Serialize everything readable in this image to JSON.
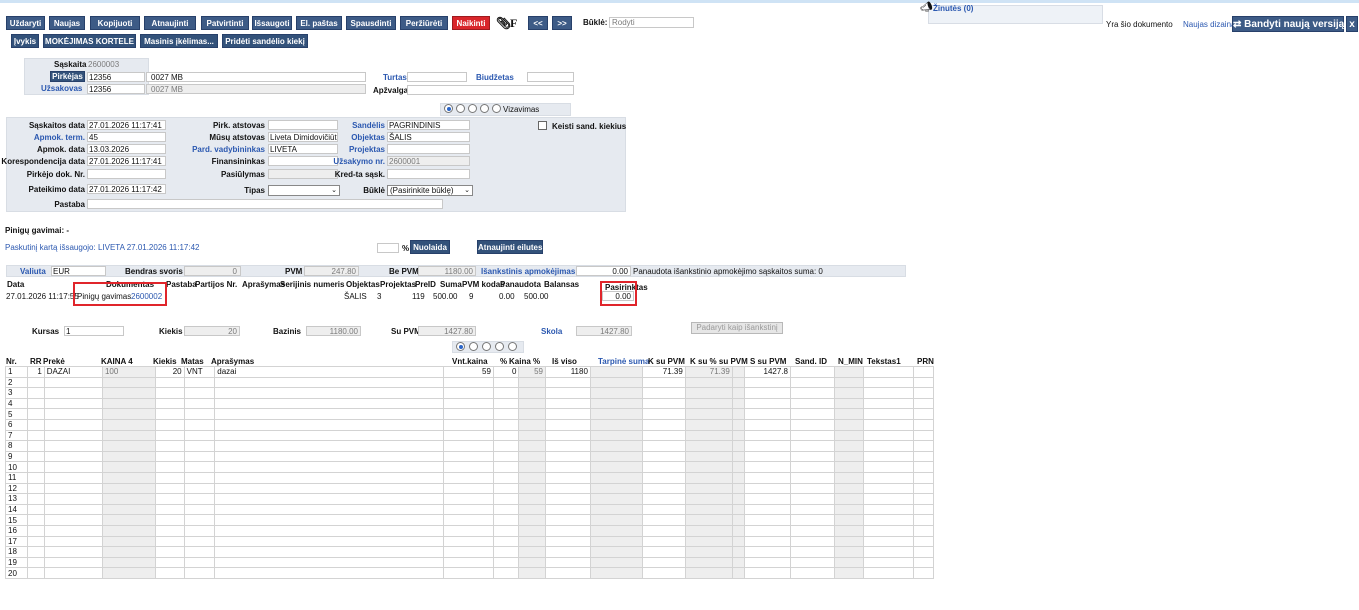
{
  "toolbar": {
    "close": "Uždaryti",
    "new": "Naujas",
    "copy": "Kopijuoti",
    "refresh": "Atnaujinti",
    "confirm": "Patvirtinti",
    "save": "Išsaugoti",
    "email": "El. paštas",
    "print": "Spausdinti",
    "preview": "Peržiūrėti",
    "cancel": "Naikinti",
    "attach_icon": "paperclip-icon",
    "f_label": "F",
    "prev": "<<",
    "next": ">>",
    "status_label": "Būklė:",
    "status_value": "Rodyti",
    "events": "Įvykis",
    "payment_card": "MOKĖJIMAS KORTELE",
    "mass_upload": "Masinis įkėlimas...",
    "add_stock": "Pridėti sandėlio kiekį"
  },
  "news": {
    "label": "Žinutės (0)",
    "icon": "megaphone-icon"
  },
  "design_notice": {
    "prefix": "Yra šio dokumento",
    "link": "Naujas dizainas.",
    "try_button": "Bandyti naują versiją",
    "close": "x"
  },
  "header": {
    "invoice_label": "Sąskaita",
    "invoice_value": "2600003",
    "buyer_label": "Pirkėjas",
    "buyer_code": "12356",
    "buyer_name": "0027 MB",
    "customer_label": "Užsakovas",
    "customer_code": "12356",
    "customer_name": "0027 MB",
    "asset_label": "Turtas",
    "budget_label": "Biudžetas",
    "insurance_label": "Apžvalga",
    "vizavimas": "Vizavimas"
  },
  "details": {
    "inv_date_label": "Sąskaitos data",
    "inv_date": "27.01.2026 11:17:41",
    "pay_term_label": "Apmok. term.",
    "pay_term": "45",
    "pay_date_label": "Apmok. data",
    "pay_date": "13.03.2026",
    "corr_date_label": "Korespondencija data",
    "corr_date": "27.01.2026 11:17:41",
    "buyer_doc_label": "Pirkėjo dok. Nr.",
    "submit_date_label": "Pateikimo data",
    "submit_date": "27.01.2026 11:17:42",
    "note_label": "Pastaba",
    "buyer_rep_label": "Pirk. atstovas",
    "our_rep_label": "Mūsų atstovas",
    "our_rep": "Liveta Dimidovičiūtė",
    "sales_mgr_label": "Pard. vadybininkas",
    "sales_mgr": "LIVETA",
    "financier_label": "Finansininkas",
    "offer_label": "Pasiūlymas",
    "type_label": "Tipas",
    "type_value": "",
    "warehouse_label": "Sandėlis",
    "warehouse": "PAGRINDINIS",
    "object_label": "Objektas",
    "object": "ŠALIS",
    "project_label": "Projektas",
    "order_label": "Užsakymo nr.",
    "order": "2600001",
    "credit_label": "Kred-ta sąsk.",
    "state_label": "Būklė",
    "state_value": "(Pasirinkite būklę)",
    "change_qty_label": "Keisti sand. kiekius"
  },
  "payments": {
    "received_label": "Pinigų gavimai: -",
    "last_saved": "Paskutinį kartą išsaugojo: LIVETA 27.01.2026 11:17:42",
    "percent_sign": "%",
    "discount_button": "Nuolaida",
    "refresh_rows_button": "Atnaujinti eilutes"
  },
  "totals": {
    "currency_label": "Valiuta",
    "currency": "EUR",
    "weight_label": "Bendras svoris",
    "weight": "0",
    "vat_label": "PVM",
    "vat": "247.80",
    "novat_label": "Be PVM",
    "novat": "1180.00",
    "prepay_label": "Išankstinis apmokėjimas",
    "prepay": "0.00",
    "prepay_used": "Panaudota išankstinio apmokėjimo sąskaitos suma: 0",
    "rate_label": "Kursas",
    "rate": "1",
    "qty_label": "Kiekis",
    "qty": "20",
    "base_label": "Bazinis",
    "base": "1180.00",
    "withvat_label": "Su PVM",
    "withvat": "1427.80",
    "debt_label": "Skola",
    "debt": "1427.80",
    "make_from_prepay": "Padaryti kaip išankstinį"
  },
  "prepay_table": {
    "headers": [
      "Data",
      "Dokumentas",
      "Pastaba",
      "Partijos Nr.",
      "Aprašymas",
      "Serijinis numeris",
      "Objektas",
      "Projektas",
      "PreID",
      "Suma",
      "PVM kodas",
      "Panaudota",
      "Balansas",
      "Pasirinktas"
    ],
    "row": {
      "date": "27.01.2026 11:17:55",
      "doc_type": "Pinigų gavimas",
      "doc_no": "2600002",
      "object": "ŠALIS",
      "project": "3",
      "preid": "119",
      "sum": "500.00",
      "vat": "9",
      "used": "0.00",
      "balance": "500.00",
      "selected": "0.00"
    }
  },
  "rows_table": {
    "headers": [
      "Nr.",
      "RR",
      "Prekė",
      "KAINA 4",
      "Kiekis",
      "Matas",
      "Aprašymas",
      "Vnt.kaina",
      "%",
      "Kaina %",
      "Iš viso",
      "Tarpinė suma",
      "K su PVM",
      "K su % su PVM",
      "S su PVM",
      "Sand. ID",
      "N_MIN",
      "Tekstas1",
      "PRN"
    ],
    "row1": {
      "nr": "1",
      "rr": "1",
      "item": "DAZAI",
      "price4": "100",
      "qty": "20",
      "unit": "VNT",
      "desc": "dazai",
      "unit_price": "59",
      "pct": "0",
      "price_pct": "59",
      "total": "1180",
      "k_vat": "71.39",
      "k_pct_vat": "71.39",
      "s_vat": "1427.8"
    },
    "row_numbers": [
      "2",
      "3",
      "4",
      "5",
      "6",
      "7",
      "8",
      "9",
      "10",
      "11",
      "12",
      "13",
      "14",
      "15",
      "16",
      "17",
      "18",
      "19",
      "20"
    ]
  }
}
